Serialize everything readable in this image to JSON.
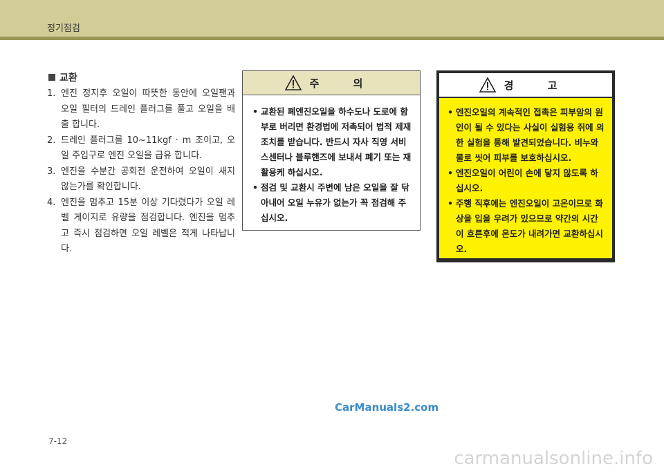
{
  "header": {
    "title": "정기점검"
  },
  "section": {
    "heading": "교환"
  },
  "steps": [
    {
      "num": "1.",
      "text": "엔진 정지후 오일이 따뜻한 동안에  오일팬과 오일 필터의 드레인 플러그를 풀고 오일을 배출 합니다."
    },
    {
      "num": "2.",
      "text": "드레인 플러그를 10~11kgf · m 조이고, 오일 주입구로 엔진 오일을 급유 합니다."
    },
    {
      "num": "3.",
      "text": "엔진을 수분간 공회전 운전하여 오일이 새지 않는가를 확인합니다."
    },
    {
      "num": "4.",
      "text": "엔진을 멈추고 15분 이상 기다렸다가 오일 레벨 게이지로 유량을 점검합니다. 엔진을 멈추고 즉시 점검하면 오일 레벨은 적게 나타납니다."
    }
  ],
  "caution": {
    "title": "주 의",
    "items": [
      "교환된 폐엔진오일을 하수도나 도로에 함부로 버리면 환경법에 저촉되어 법적 제재조치를 받습니다. 반드시 자사 직영 서비스센터나 블루핸즈에 보내서 폐기 또는 재활용케 하십시오.",
      "점검 및 교환시 주변에 남은 오일을 잘 닦아내어 오일 누유가 없는가 꼭 점검해 주십시오."
    ]
  },
  "warning": {
    "title": "경 고",
    "items": [
      "엔진오일의 계속적인 접촉은 피부암의 원인이 될 수 있다는 사실이 실험용 쥐에 의한 실험을 통해 발견되었습니다. 비누와 물로 씻어 피부를 보호하십시오.",
      "엔진오일이 어린이 손에 닿지 않도록 하십시오.",
      "주행 직후에는 엔진오일이 고온이므로 화상을 입을 우려가 있으므로 약간의 시간이 흐른후에 온도가 내려가면 교환하십시오."
    ],
    "color": "#fff200"
  },
  "bullet_symbol": "•",
  "watermark": "CarManuals2.com",
  "page_number": "7-12",
  "footer_watermark": "carmanualsonline.info"
}
